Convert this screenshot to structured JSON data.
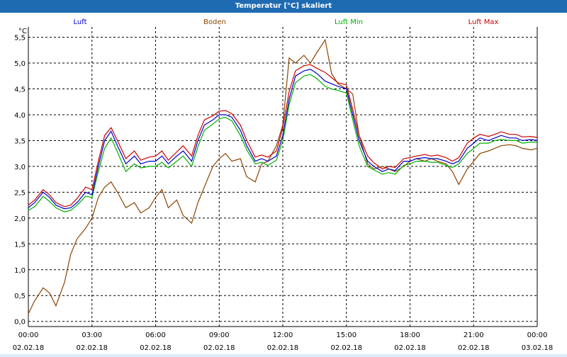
{
  "window": {
    "title": "Temperatur [°C] skaliert"
  },
  "chart_data": {
    "type": "line",
    "title": "Temperatur [°C] skaliert",
    "ylabel": "°C",
    "xlabel": "",
    "ylim": [
      -0.1,
      5.7
    ],
    "yticks": [
      0.0,
      0.5,
      1.0,
      1.5,
      2.0,
      2.5,
      3.0,
      3.5,
      4.0,
      4.5,
      5.0,
      5.5
    ],
    "ytick_labels": [
      "0,0",
      "0,5",
      "1,0",
      "1,5",
      "2,0",
      "2,5",
      "3,0",
      "3,5",
      "4,0",
      "4,5",
      "5,0",
      "5,5"
    ],
    "xlim": [
      0,
      24
    ],
    "xtick_labels": [
      {
        "time": "00:00",
        "date": "02.02.18"
      },
      {
        "time": "03:00",
        "date": "02.02.18"
      },
      {
        "time": "06:00",
        "date": "02.02.18"
      },
      {
        "time": "09:00",
        "date": "02.02.18"
      },
      {
        "time": "12:00",
        "date": "02.02.18"
      },
      {
        "time": "15:00",
        "date": "02.02.18"
      },
      {
        "time": "18:00",
        "date": "02.02.18"
      },
      {
        "time": "21:00",
        "date": "02.02.18"
      },
      {
        "time": "00:00",
        "date": "03.02.18"
      }
    ],
    "grid": true,
    "legend_position": "top",
    "series": [
      {
        "name": "Luft",
        "color": "#0000cc",
        "points": [
          [
            0,
            2.2
          ],
          [
            0.3,
            2.3
          ],
          [
            0.7,
            2.5
          ],
          [
            1.0,
            2.4
          ],
          [
            1.3,
            2.25
          ],
          [
            1.7,
            2.18
          ],
          [
            2.0,
            2.2
          ],
          [
            2.3,
            2.3
          ],
          [
            2.7,
            2.5
          ],
          [
            3.0,
            2.45
          ],
          [
            3.3,
            3.0
          ],
          [
            3.6,
            3.5
          ],
          [
            3.9,
            3.68
          ],
          [
            4.2,
            3.4
          ],
          [
            4.6,
            3.05
          ],
          [
            5.0,
            3.2
          ],
          [
            5.3,
            3.05
          ],
          [
            5.7,
            3.1
          ],
          [
            6.0,
            3.1
          ],
          [
            6.3,
            3.2
          ],
          [
            6.6,
            3.05
          ],
          [
            7.0,
            3.2
          ],
          [
            7.3,
            3.3
          ],
          [
            7.7,
            3.1
          ],
          [
            8.0,
            3.5
          ],
          [
            8.3,
            3.8
          ],
          [
            8.7,
            3.9
          ],
          [
            9.0,
            4.0
          ],
          [
            9.3,
            4.0
          ],
          [
            9.6,
            3.95
          ],
          [
            10.0,
            3.7
          ],
          [
            10.3,
            3.4
          ],
          [
            10.7,
            3.1
          ],
          [
            11.0,
            3.15
          ],
          [
            11.3,
            3.1
          ],
          [
            11.7,
            3.2
          ],
          [
            12.0,
            3.6
          ],
          [
            12.3,
            4.3
          ],
          [
            12.6,
            4.75
          ],
          [
            13.0,
            4.85
          ],
          [
            13.3,
            4.88
          ],
          [
            13.6,
            4.8
          ],
          [
            14.0,
            4.65
          ],
          [
            14.3,
            4.6
          ],
          [
            14.6,
            4.55
          ],
          [
            15.0,
            4.5
          ],
          [
            15.3,
            4.0
          ],
          [
            15.6,
            3.5
          ],
          [
            16.0,
            3.1
          ],
          [
            16.3,
            3.0
          ],
          [
            16.7,
            2.9
          ],
          [
            17.0,
            2.95
          ],
          [
            17.3,
            2.92
          ],
          [
            17.7,
            3.1
          ],
          [
            18.0,
            3.1
          ],
          [
            18.3,
            3.15
          ],
          [
            18.7,
            3.17
          ],
          [
            19.0,
            3.15
          ],
          [
            19.3,
            3.15
          ],
          [
            19.7,
            3.1
          ],
          [
            20.0,
            3.05
          ],
          [
            20.3,
            3.1
          ],
          [
            20.7,
            3.35
          ],
          [
            21.0,
            3.45
          ],
          [
            21.3,
            3.55
          ],
          [
            21.7,
            3.5
          ],
          [
            22.0,
            3.55
          ],
          [
            22.3,
            3.6
          ],
          [
            22.7,
            3.55
          ],
          [
            23.0,
            3.55
          ],
          [
            23.3,
            3.5
          ],
          [
            23.7,
            3.52
          ],
          [
            24.0,
            3.5
          ]
        ]
      },
      {
        "name": "Boden",
        "color": "#8b4500",
        "points": [
          [
            0,
            0.15
          ],
          [
            0.3,
            0.4
          ],
          [
            0.7,
            0.65
          ],
          [
            1.0,
            0.55
          ],
          [
            1.3,
            0.3
          ],
          [
            1.7,
            0.75
          ],
          [
            2.0,
            1.3
          ],
          [
            2.3,
            1.6
          ],
          [
            2.7,
            1.8
          ],
          [
            3.0,
            2.0
          ],
          [
            3.3,
            2.4
          ],
          [
            3.6,
            2.6
          ],
          [
            3.9,
            2.7
          ],
          [
            4.2,
            2.5
          ],
          [
            4.6,
            2.2
          ],
          [
            5.0,
            2.3
          ],
          [
            5.3,
            2.1
          ],
          [
            5.7,
            2.2
          ],
          [
            6.0,
            2.4
          ],
          [
            6.3,
            2.55
          ],
          [
            6.6,
            2.2
          ],
          [
            7.0,
            2.35
          ],
          [
            7.3,
            2.05
          ],
          [
            7.7,
            1.9
          ],
          [
            8.0,
            2.3
          ],
          [
            8.3,
            2.6
          ],
          [
            8.7,
            3.0
          ],
          [
            9.0,
            3.15
          ],
          [
            9.3,
            3.25
          ],
          [
            9.6,
            3.1
          ],
          [
            10.0,
            3.15
          ],
          [
            10.3,
            2.8
          ],
          [
            10.7,
            2.7
          ],
          [
            11.0,
            3.05
          ],
          [
            11.3,
            3.1
          ],
          [
            11.7,
            3.4
          ],
          [
            12.0,
            3.8
          ],
          [
            12.3,
            5.1
          ],
          [
            12.6,
            5.0
          ],
          [
            13.0,
            5.15
          ],
          [
            13.3,
            5.0
          ],
          [
            13.6,
            5.2
          ],
          [
            14.0,
            5.45
          ],
          [
            14.3,
            4.8
          ],
          [
            14.6,
            4.6
          ],
          [
            15.0,
            4.5
          ],
          [
            15.3,
            4.4
          ],
          [
            15.6,
            3.6
          ],
          [
            16.0,
            3.05
          ],
          [
            16.3,
            2.95
          ],
          [
            16.7,
            3.0
          ],
          [
            17.0,
            2.95
          ],
          [
            17.3,
            2.9
          ],
          [
            17.7,
            3.0
          ],
          [
            18.0,
            3.1
          ],
          [
            18.3,
            3.15
          ],
          [
            18.7,
            3.1
          ],
          [
            19.0,
            3.15
          ],
          [
            19.3,
            3.1
          ],
          [
            19.7,
            3.05
          ],
          [
            20.0,
            2.9
          ],
          [
            20.3,
            2.65
          ],
          [
            20.7,
            2.95
          ],
          [
            21.0,
            3.1
          ],
          [
            21.3,
            3.25
          ],
          [
            21.7,
            3.3
          ],
          [
            22.0,
            3.35
          ],
          [
            22.3,
            3.4
          ],
          [
            22.7,
            3.42
          ],
          [
            23.0,
            3.4
          ],
          [
            23.3,
            3.35
          ],
          [
            23.7,
            3.32
          ],
          [
            24.0,
            3.35
          ]
        ]
      },
      {
        "name": "Luft Min",
        "color": "#00b000",
        "points": [
          [
            0,
            2.15
          ],
          [
            0.3,
            2.22
          ],
          [
            0.7,
            2.42
          ],
          [
            1.0,
            2.32
          ],
          [
            1.3,
            2.2
          ],
          [
            1.7,
            2.12
          ],
          [
            2.0,
            2.15
          ],
          [
            2.3,
            2.25
          ],
          [
            2.7,
            2.42
          ],
          [
            3.0,
            2.4
          ],
          [
            3.3,
            2.9
          ],
          [
            3.6,
            3.35
          ],
          [
            3.9,
            3.55
          ],
          [
            4.2,
            3.28
          ],
          [
            4.6,
            2.9
          ],
          [
            5.0,
            3.05
          ],
          [
            5.3,
            2.97
          ],
          [
            5.7,
            3.0
          ],
          [
            6.0,
            3.0
          ],
          [
            6.3,
            3.08
          ],
          [
            6.6,
            2.97
          ],
          [
            7.0,
            3.1
          ],
          [
            7.3,
            3.2
          ],
          [
            7.7,
            3.0
          ],
          [
            8.0,
            3.38
          ],
          [
            8.3,
            3.7
          ],
          [
            8.7,
            3.82
          ],
          [
            9.0,
            3.92
          ],
          [
            9.3,
            3.95
          ],
          [
            9.6,
            3.88
          ],
          [
            10.0,
            3.6
          ],
          [
            10.3,
            3.32
          ],
          [
            10.7,
            3.05
          ],
          [
            11.0,
            3.08
          ],
          [
            11.3,
            3.02
          ],
          [
            11.7,
            3.12
          ],
          [
            12.0,
            3.5
          ],
          [
            12.3,
            4.2
          ],
          [
            12.6,
            4.62
          ],
          [
            13.0,
            4.75
          ],
          [
            13.3,
            4.78
          ],
          [
            13.6,
            4.7
          ],
          [
            14.0,
            4.55
          ],
          [
            14.3,
            4.5
          ],
          [
            14.6,
            4.47
          ],
          [
            15.0,
            4.42
          ],
          [
            15.3,
            3.9
          ],
          [
            15.6,
            3.4
          ],
          [
            16.0,
            3.0
          ],
          [
            16.3,
            2.93
          ],
          [
            16.7,
            2.85
          ],
          [
            17.0,
            2.88
          ],
          [
            17.3,
            2.85
          ],
          [
            17.7,
            3.02
          ],
          [
            18.0,
            3.05
          ],
          [
            18.3,
            3.1
          ],
          [
            18.7,
            3.1
          ],
          [
            19.0,
            3.08
          ],
          [
            19.3,
            3.08
          ],
          [
            19.7,
            3.02
          ],
          [
            20.0,
            2.98
          ],
          [
            20.3,
            3.05
          ],
          [
            20.7,
            3.25
          ],
          [
            21.0,
            3.35
          ],
          [
            21.3,
            3.45
          ],
          [
            21.7,
            3.45
          ],
          [
            22.0,
            3.5
          ],
          [
            22.3,
            3.52
          ],
          [
            22.7,
            3.5
          ],
          [
            23.0,
            3.5
          ],
          [
            23.3,
            3.45
          ],
          [
            23.7,
            3.47
          ],
          [
            24.0,
            3.47
          ]
        ]
      },
      {
        "name": "Luft Max",
        "color": "#cc0000",
        "points": [
          [
            0,
            2.25
          ],
          [
            0.3,
            2.35
          ],
          [
            0.7,
            2.55
          ],
          [
            1.0,
            2.45
          ],
          [
            1.3,
            2.3
          ],
          [
            1.7,
            2.22
          ],
          [
            2.0,
            2.25
          ],
          [
            2.3,
            2.38
          ],
          [
            2.7,
            2.6
          ],
          [
            3.0,
            2.55
          ],
          [
            3.3,
            3.1
          ],
          [
            3.6,
            3.6
          ],
          [
            3.9,
            3.75
          ],
          [
            4.2,
            3.5
          ],
          [
            4.6,
            3.15
          ],
          [
            5.0,
            3.3
          ],
          [
            5.3,
            3.12
          ],
          [
            5.7,
            3.18
          ],
          [
            6.0,
            3.2
          ],
          [
            6.3,
            3.3
          ],
          [
            6.6,
            3.12
          ],
          [
            7.0,
            3.28
          ],
          [
            7.3,
            3.4
          ],
          [
            7.7,
            3.2
          ],
          [
            8.0,
            3.6
          ],
          [
            8.3,
            3.9
          ],
          [
            8.7,
            3.98
          ],
          [
            9.0,
            4.07
          ],
          [
            9.3,
            4.08
          ],
          [
            9.6,
            4.02
          ],
          [
            10.0,
            3.8
          ],
          [
            10.3,
            3.5
          ],
          [
            10.7,
            3.18
          ],
          [
            11.0,
            3.22
          ],
          [
            11.3,
            3.18
          ],
          [
            11.7,
            3.3
          ],
          [
            12.0,
            3.75
          ],
          [
            12.3,
            4.45
          ],
          [
            12.6,
            4.85
          ],
          [
            13.0,
            4.95
          ],
          [
            13.3,
            4.97
          ],
          [
            13.6,
            4.9
          ],
          [
            14.0,
            4.82
          ],
          [
            14.3,
            4.72
          ],
          [
            14.6,
            4.62
          ],
          [
            15.0,
            4.58
          ],
          [
            15.3,
            4.1
          ],
          [
            15.6,
            3.6
          ],
          [
            16.0,
            3.2
          ],
          [
            16.3,
            3.07
          ],
          [
            16.7,
            2.95
          ],
          [
            17.0,
            3.0
          ],
          [
            17.3,
            2.98
          ],
          [
            17.7,
            3.15
          ],
          [
            18.0,
            3.17
          ],
          [
            18.3,
            3.2
          ],
          [
            18.7,
            3.23
          ],
          [
            19.0,
            3.2
          ],
          [
            19.3,
            3.22
          ],
          [
            19.7,
            3.17
          ],
          [
            20.0,
            3.1
          ],
          [
            20.3,
            3.17
          ],
          [
            20.7,
            3.45
          ],
          [
            21.0,
            3.55
          ],
          [
            21.3,
            3.62
          ],
          [
            21.7,
            3.58
          ],
          [
            22.0,
            3.62
          ],
          [
            22.3,
            3.67
          ],
          [
            22.7,
            3.62
          ],
          [
            23.0,
            3.62
          ],
          [
            23.3,
            3.57
          ],
          [
            23.7,
            3.58
          ],
          [
            24.0,
            3.56
          ]
        ]
      }
    ]
  }
}
